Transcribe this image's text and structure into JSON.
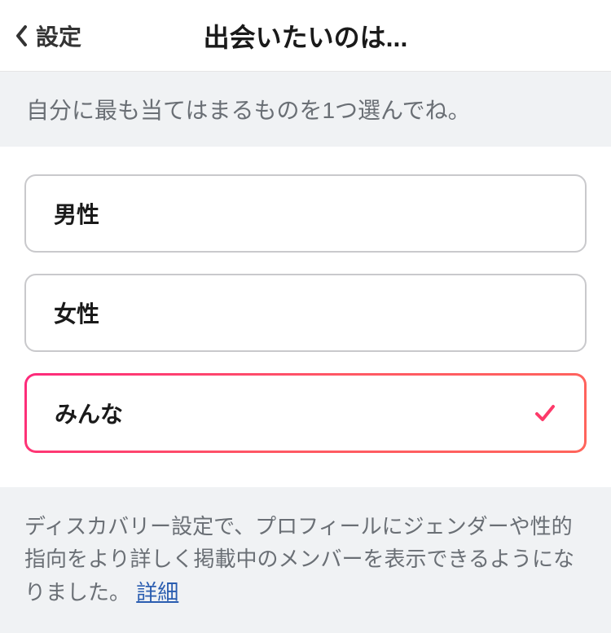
{
  "header": {
    "back_label": "設定",
    "title": "出会いたいのは..."
  },
  "instruction": "自分に最も当てはまるものを1つ選んでね。",
  "options": [
    {
      "label": "男性",
      "selected": false
    },
    {
      "label": "女性",
      "selected": false
    },
    {
      "label": "みんな",
      "selected": true
    }
  ],
  "footer": {
    "text": "ディスカバリー設定で、プロフィールにジェンダーや性的指向をより詳しく掲載中のメンバーを表示できるようになりました。",
    "link_label": "詳細"
  }
}
